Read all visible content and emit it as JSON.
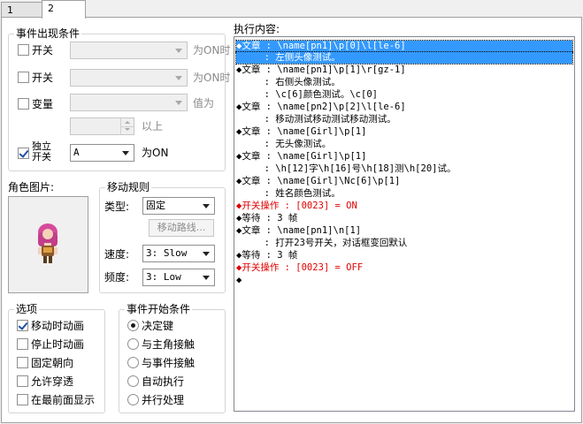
{
  "tabs": [
    {
      "label": "1"
    },
    {
      "label": "2"
    }
  ],
  "conditions": {
    "title": "事件出现条件",
    "switch1_label": "开关",
    "switch1_suffix": "为ON时",
    "switch2_label": "开关",
    "switch2_suffix": "为ON时",
    "variable_label": "变量",
    "variable_suffix": "值为",
    "variable_above": "以上",
    "self_switch_label_line1": "独立",
    "self_switch_label_line2": "开关",
    "self_switch_value": "A",
    "self_switch_suffix": "为ON"
  },
  "graphic": {
    "title": "角色图片:"
  },
  "movement": {
    "title": "移动规则",
    "type_label": "类型:",
    "type_value": "固定",
    "route_button": "移动路线...",
    "speed_label": "速度:",
    "speed_value": "3: Slow",
    "freq_label": "频度:",
    "freq_value": "3: Low"
  },
  "options": {
    "title": "选项",
    "items": [
      {
        "label": "移动时动画",
        "checked": true
      },
      {
        "label": "停止时动画",
        "checked": false
      },
      {
        "label": "固定朝向",
        "checked": false
      },
      {
        "label": "允许穿透",
        "checked": false
      },
      {
        "label": "在最前面显示",
        "checked": false
      }
    ]
  },
  "trigger": {
    "title": "事件开始条件",
    "items": [
      {
        "label": "决定键",
        "checked": true
      },
      {
        "label": "与主角接触",
        "checked": false
      },
      {
        "label": "与事件接触",
        "checked": false
      },
      {
        "label": "自动执行",
        "checked": false
      },
      {
        "label": "并行处理",
        "checked": false
      }
    ]
  },
  "contents": {
    "title": "执行内容:",
    "lines": [
      {
        "text": "◆文章 : \\name[pn1]\\p[0]\\l[le-6]",
        "style": "sel"
      },
      {
        "text": "     : 左侧头像测试。",
        "style": "sel"
      },
      {
        "text": "◆文章 : \\name[pn1]\\p[1]\\r[gz-1]",
        "style": ""
      },
      {
        "text": "     : 右侧头像测试。",
        "style": ""
      },
      {
        "text": "     : \\c[6]颜色测试。\\c[0]",
        "style": ""
      },
      {
        "text": "◆文章 : \\name[pn2]\\p[2]\\l[le-6]",
        "style": ""
      },
      {
        "text": "     : 移动测试移动测试移动测试。",
        "style": ""
      },
      {
        "text": "◆文章 : \\name[Girl]\\p[1]",
        "style": ""
      },
      {
        "text": "     : 无头像测试。",
        "style": ""
      },
      {
        "text": "◆文章 : \\name[Girl]\\p[1]",
        "style": ""
      },
      {
        "text": "     : \\h[12]字\\h[16]号\\h[18]测\\h[20]试。",
        "style": ""
      },
      {
        "text": "◆文章 : \\name[Girl]\\Nc[6]\\p[1]",
        "style": ""
      },
      {
        "text": "     : 姓名颜色测试。",
        "style": ""
      },
      {
        "text": "◆开关操作 : [0023] = ON",
        "style": "red"
      },
      {
        "text": "◆等待 : 3 帧",
        "style": ""
      },
      {
        "text": "◆文章 : \\name[pn1]\\n[1]",
        "style": ""
      },
      {
        "text": "     : 打开23号开关，对话框变回默认",
        "style": ""
      },
      {
        "text": "◆等待 : 3 帧",
        "style": ""
      },
      {
        "text": "◆开关操作 : [0023] = OFF",
        "style": "red"
      },
      {
        "text": "◆",
        "style": ""
      }
    ]
  }
}
